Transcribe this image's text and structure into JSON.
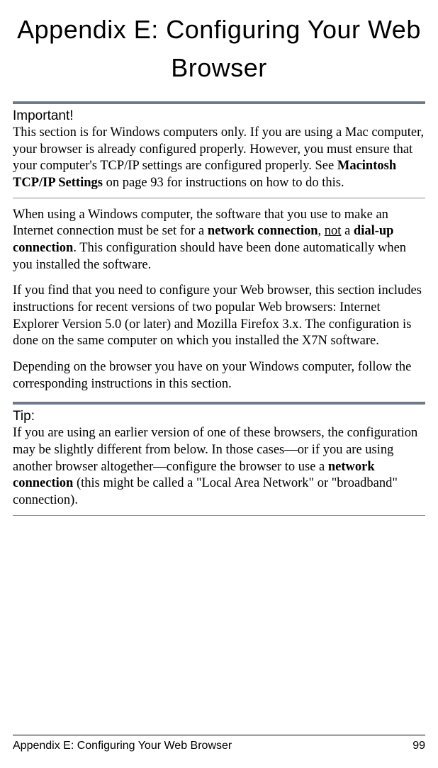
{
  "title": "Appendix E: Configuring Your Web Browser",
  "important": {
    "heading": "Important!",
    "t1": "This section is for Windows computers only. If you are using a Mac computer, your browser is already configured properly. However, you must ensure that your computer's TCP/IP settings are configured properly. See ",
    "bold1": "Macintosh TCP/IP Settings",
    "t2": " on page 93 for instructions on how to do this."
  },
  "para1": {
    "t1": "When using a Windows computer, the software that you use to make an Internet connection must be set for a ",
    "bold1": "network connection",
    "t2": ", ",
    "underline1": "not",
    "t3": " a ",
    "bold2": "dial-up connection",
    "t4": ". This configuration should have been done automatically when you installed the software."
  },
  "para2": "If you find that you need to configure your Web browser, this section includes instructions for recent versions of two popular Web browsers: Internet Explorer Version 5.0 (or later) and Mozilla Firefox 3.x. The configuration is done on the same computer on which you installed the X7N software.",
  "para3": "Depending on the browser you have on your Windows computer, follow the corresponding instructions in this section.",
  "tip": {
    "heading": "Tip:",
    "t1": "If you are using an earlier version of one of these browsers, the configuration may be slightly different from below. In those cases—or if you are using another browser altogether—configure the browser to use a ",
    "bold1": "network connection",
    "t2": " (this might be called a \"Local Area Network\" or \"broadband\" connection)."
  },
  "footer": {
    "left": "Appendix E: Configuring Your Web Browser",
    "right": "99"
  }
}
